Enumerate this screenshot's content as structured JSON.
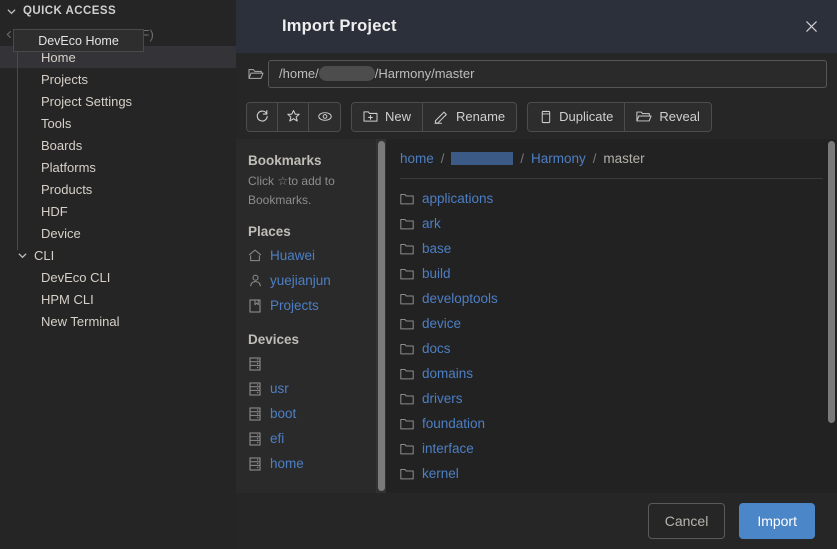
{
  "app_sidebar": {
    "quick_access_label": "QUICK ACCESS",
    "search_placeholder": "Search (Ctrl+Shift+F)",
    "tooltip": "DevEco Home",
    "items": [
      {
        "label": "Home",
        "active": true
      },
      {
        "label": "Projects",
        "active": false
      },
      {
        "label": "Project Settings",
        "active": false
      },
      {
        "label": "Tools",
        "active": false
      },
      {
        "label": "Boards",
        "active": false
      },
      {
        "label": "Platforms",
        "active": false
      },
      {
        "label": "Products",
        "active": false
      },
      {
        "label": "HDF",
        "active": false
      },
      {
        "label": "Device",
        "active": false
      }
    ],
    "cli_group_label": "CLI",
    "cli_items": [
      {
        "label": "DevEco CLI"
      },
      {
        "label": "HPM CLI"
      },
      {
        "label": "New Terminal"
      }
    ]
  },
  "dialog": {
    "title": "Import Project",
    "close_label": "✕",
    "path": {
      "prefix": "/home/",
      "redacted": true,
      "suffix": "/Harmony/master"
    },
    "toolbar": {
      "icon_buttons": [
        {
          "name": "refresh-icon",
          "label": ""
        },
        {
          "name": "star-icon",
          "label": ""
        },
        {
          "name": "eye-icon",
          "label": ""
        }
      ],
      "new_label": "New",
      "rename_label": "Rename",
      "duplicate_label": "Duplicate",
      "reveal_label": "Reveal"
    },
    "places_panel": {
      "bookmarks_heading": "Bookmarks",
      "bookmarks_note_line1": "Click ☆to add to",
      "bookmarks_note_line2": "Bookmarks.",
      "places_heading": "Places",
      "places": [
        {
          "label": "Huawei",
          "icon": "home-icon"
        },
        {
          "label": "yuejianjun",
          "icon": "person-icon"
        },
        {
          "label": "Projects",
          "icon": "bookmark-icon"
        }
      ],
      "devices_heading": "Devices",
      "devices": [
        {
          "label": "",
          "icon": "drive-icon"
        },
        {
          "label": "usr",
          "icon": "drive-icon"
        },
        {
          "label": "boot",
          "icon": "drive-icon"
        },
        {
          "label": "efi",
          "icon": "drive-icon"
        },
        {
          "label": "home",
          "icon": "drive-icon"
        }
      ]
    },
    "breadcrumb": [
      {
        "label": "home",
        "current": false,
        "redacted": false
      },
      {
        "label": "",
        "current": false,
        "redacted": true
      },
      {
        "label": "Harmony",
        "current": false,
        "redacted": false
      },
      {
        "label": "master",
        "current": true,
        "redacted": false
      }
    ],
    "breadcrumb_separator": "/",
    "files": [
      {
        "name": "applications",
        "type": "folder"
      },
      {
        "name": "ark",
        "type": "folder"
      },
      {
        "name": "base",
        "type": "folder"
      },
      {
        "name": "build",
        "type": "folder"
      },
      {
        "name": "developtools",
        "type": "folder"
      },
      {
        "name": "device",
        "type": "folder"
      },
      {
        "name": "docs",
        "type": "folder"
      },
      {
        "name": "domains",
        "type": "folder"
      },
      {
        "name": "drivers",
        "type": "folder"
      },
      {
        "name": "foundation",
        "type": "folder"
      },
      {
        "name": "interface",
        "type": "folder"
      },
      {
        "name": "kernel",
        "type": "folder"
      }
    ],
    "footer": {
      "cancel_label": "Cancel",
      "import_label": "Import"
    }
  },
  "colors": {
    "accent_blue": "#4a86c8",
    "link_blue": "#4d7fc4",
    "titlebar": "#2b303a",
    "window_bg": "#252525",
    "panel_bg": "#2a2a2a",
    "filelist_bg": "#222222"
  }
}
